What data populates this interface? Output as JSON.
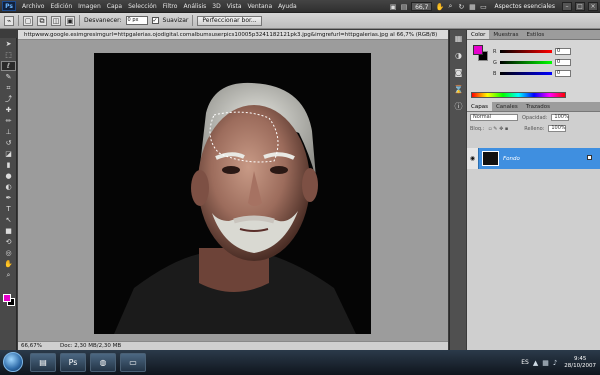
{
  "app": {
    "logo": "Ps"
  },
  "menu": {
    "items": [
      "Archivo",
      "Edición",
      "Imagen",
      "Capa",
      "Selección",
      "Filtro",
      "Análisis",
      "3D",
      "Vista",
      "Ventana",
      "Ayuda"
    ],
    "zoom": "66,7",
    "workspace": "Aspectos esenciales"
  },
  "options": {
    "feather_label": "Desvanecer:",
    "feather_value": "0 px",
    "smooth_label": "Suavizar",
    "refine_label": "Perfeccionar bor..."
  },
  "document": {
    "tab_title": "httpwww.google.esimgresimgurl=httpgalerias.ojodigital.comalbumsuserpics10005p3241182121pk3.jpg&imgrefurl=httpgalerias.jpg al 66,7% (RGB/8)"
  },
  "status": {
    "zoom": "66,67%",
    "doc_info": "Doc: 2,30 MB/2,30 MB"
  },
  "colors": {
    "foreground": "#e600cc",
    "background": "#000000",
    "selection": "#3f8fe0"
  },
  "color_panel": {
    "tabs": [
      "Color",
      "Muestras",
      "Estilos"
    ],
    "r": "0",
    "g": "0",
    "b": "0"
  },
  "layers_panel": {
    "tabs": [
      "Capas",
      "Canales",
      "Trazados"
    ],
    "blend_mode": "Normal",
    "opacity_label": "Opacidad:",
    "opacity_value": "100%",
    "lock_label": "Bloq.:",
    "fill_label": "Relleno:",
    "fill_value": "100%",
    "layer_name": "Fondo"
  },
  "taskbar": {
    "language": "ES",
    "time": "9:45",
    "date": "28/10/2007"
  }
}
